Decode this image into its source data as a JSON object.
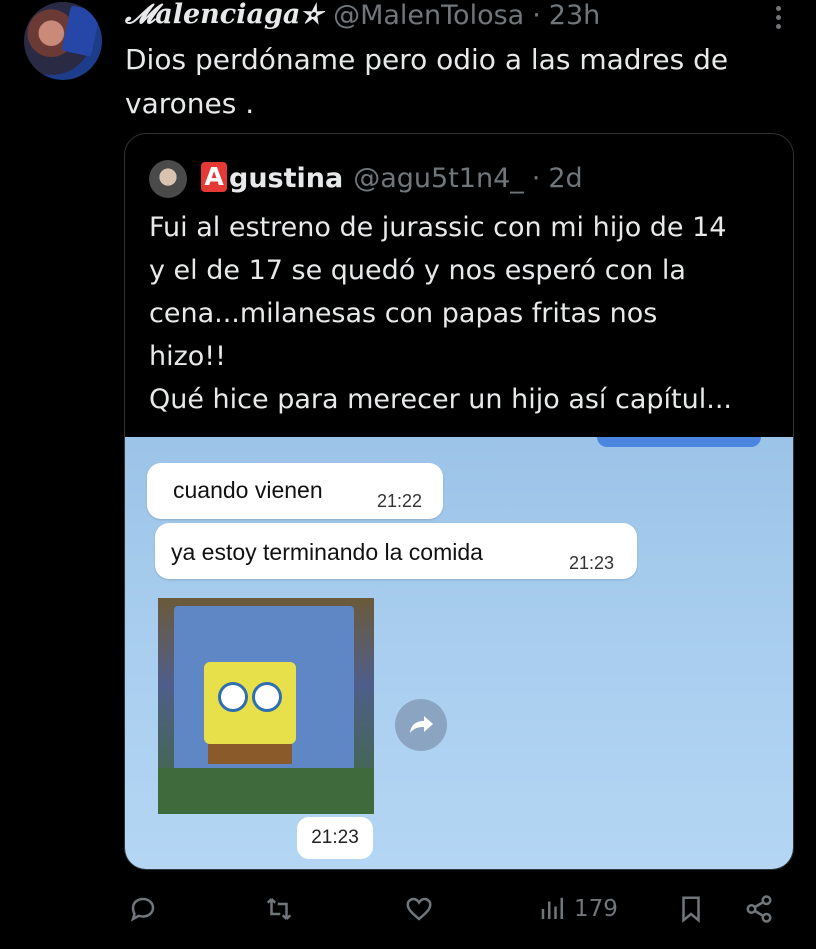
{
  "tweet": {
    "display_name": "𝓜alenciaga✫",
    "handle": "@MalenTolosa",
    "separator": "·",
    "time": "23h",
    "text": "Dios perdóname pero odio a las madres de varones ."
  },
  "quoted": {
    "badge_letter": "A",
    "display_name": "gustina",
    "handle": "@agu5t1n4_",
    "separator": "·",
    "time": "2d",
    "text_lines": [
      "Fui al estreno de jurassic con mi hijo de 14",
      "y el de 17 se quedó y nos esperó con la",
      "cena...milanesas con papas fritas nos",
      "hizo!!",
      "Qué hice para merecer un hijo así capítul..."
    ],
    "chat": {
      "messages": [
        {
          "text": "cuando vienen",
          "time": "21:22"
        },
        {
          "text": "ya estoy terminando la comida",
          "time": "21:23"
        }
      ],
      "sticker_time": "21:23"
    }
  },
  "actions": {
    "views_count": "179"
  },
  "colors": {
    "background": "#000000",
    "text": "#e7e9ea",
    "muted": "#71767b",
    "border": "#2f3336",
    "badge_red": "#e53935"
  }
}
